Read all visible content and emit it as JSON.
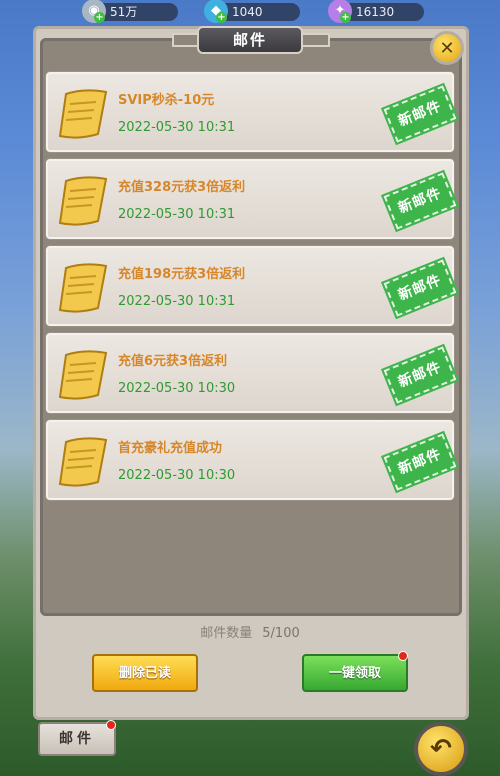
{
  "currencies": [
    {
      "icon": "silver-coin-icon",
      "value": "51万"
    },
    {
      "icon": "diamond-icon",
      "value": "1040"
    },
    {
      "icon": "gem-icon",
      "value": "16130"
    }
  ],
  "panel": {
    "title": "邮件"
  },
  "mails": [
    {
      "title": "SVIP秒杀-10元",
      "time": "2022-05-30  10:31",
      "badge": "新邮件"
    },
    {
      "title": "充值328元获3倍返利",
      "time": "2022-05-30  10:31",
      "badge": "新邮件"
    },
    {
      "title": "充值198元获3倍返利",
      "time": "2022-05-30  10:31",
      "badge": "新邮件"
    },
    {
      "title": "充值6元获3倍返利",
      "time": "2022-05-30  10:30",
      "badge": "新邮件"
    },
    {
      "title": "首充豪礼充值成功",
      "time": "2022-05-30  10:30",
      "badge": "新邮件"
    }
  ],
  "footer": {
    "count_label": "邮件数量",
    "count_value": "5/100",
    "delete_read_label": "删除已读",
    "claim_all_label": "一键领取"
  },
  "bottom": {
    "tab_label": "邮件"
  },
  "colors": {
    "title_orange": "#d7872a",
    "time_green": "#2f9a2f",
    "badge_green": "#3db54a"
  }
}
